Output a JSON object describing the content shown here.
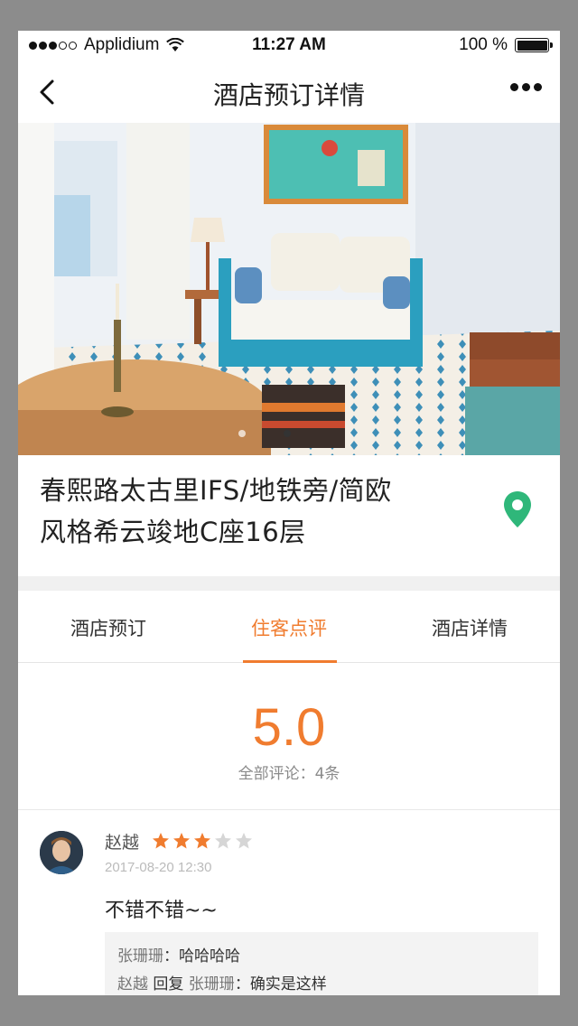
{
  "status_bar": {
    "carrier": "Applidium",
    "time": "11:27 AM",
    "battery": "100 %",
    "signal_dots_filled": 3,
    "signal_dots_total": 5
  },
  "nav": {
    "title": "酒店预订详情",
    "back_icon": "chevron-left-icon",
    "more_icon": "more-dots-icon"
  },
  "hero": {
    "image_alt": "hotel-room-photo",
    "pager_active": 1,
    "pager_total": 2
  },
  "hotel": {
    "title_line1": "春熙路太古里IFS/地铁旁/简欧",
    "title_line2": "风格希云竣地C座16层",
    "location_icon": "map-pin-icon",
    "accent_color": "#2fb77a"
  },
  "tabs": [
    {
      "label": "酒店预订",
      "active": false
    },
    {
      "label": "住客点评",
      "active": true
    },
    {
      "label": "酒店详情",
      "active": false
    }
  ],
  "rating": {
    "score": "5.0",
    "summary": "全部评论：4条",
    "accent_color": "#f07c2f"
  },
  "reviews": [
    {
      "author": "赵越",
      "stars": 3,
      "max_stars": 5,
      "date": "2017-08-20 12:30",
      "text": "不错不错~~",
      "replies": [
        {
          "from": "张珊珊",
          "sep": "：",
          "text": "哈哈哈哈"
        },
        {
          "from": "赵越",
          "action": "回复",
          "to": "张珊珊",
          "sep": "：",
          "text": "确实是这样"
        }
      ]
    }
  ]
}
